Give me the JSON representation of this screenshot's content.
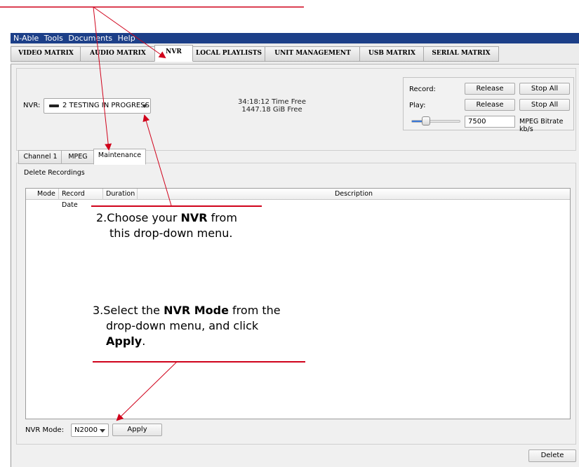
{
  "menu": [
    "N-Able",
    "Tools",
    "Documents",
    "Help"
  ],
  "tabs": [
    "VIDEO MATRIX",
    "AUDIO MATRIX",
    "NVR",
    "LOCAL PLAYLISTS",
    "UNIT MANAGEMENT",
    "USB MATRIX",
    "SERIAL MATRIX"
  ],
  "active_tab": "NVR",
  "nvr": {
    "label": "NVR:",
    "selected": "2 TESTING IN PROGRESS",
    "time_free": "34:18:12 Time Free",
    "gib_free": "1447.18 GiB Free"
  },
  "record_play": {
    "record_label": "Record:",
    "play_label": "Play:",
    "release_label": "Release",
    "stop_all_label": "Stop All",
    "bitrate_value": "7500",
    "bitrate_label": "MPEG Bitrate kb/s",
    "bitrate_slider_fraction": 0.3
  },
  "subtabs": [
    "Channel 1",
    "MPEG",
    "Maintenance"
  ],
  "active_subtab": "Maintenance",
  "maintenance": {
    "section_label": "Delete Recordings",
    "columns": [
      "Mode",
      "Record Date",
      "Duration",
      "Description"
    ],
    "nvr_mode_label": "NVR Mode:",
    "nvr_mode_value": "N2000",
    "apply_label": "Apply",
    "delete_label": "Delete"
  },
  "annotations": {
    "step2_prefix": "2.",
    "step2_a": "Choose your ",
    "step2_b": "NVR",
    "step2_c": " from",
    "step2_line2": "this drop-down menu.",
    "step3_prefix": "3.",
    "step3_a": "Select the ",
    "step3_b": "NVR Mode",
    "step3_c": " from the",
    "step3_line2": "drop-down menu, and click",
    "step3_line3_b": "Apply",
    "step3_line3_c": "."
  },
  "colors": {
    "menubar": "#1c3f88",
    "annotation_red": "#d0021b"
  }
}
